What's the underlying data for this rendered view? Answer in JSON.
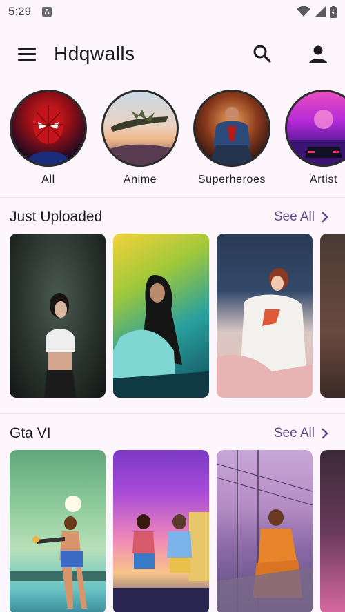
{
  "status_bar": {
    "time": "5:29",
    "notification_icon": "a-icon",
    "right_icons": [
      "wifi-icon",
      "signal-icon",
      "battery-icon"
    ]
  },
  "app_bar": {
    "title": "Hdqwalls",
    "left_icon": "menu-icon",
    "right_icons": [
      "search-icon",
      "account-icon"
    ]
  },
  "categories": [
    {
      "label": "All"
    },
    {
      "label": "Anime"
    },
    {
      "label": "Superheroes"
    },
    {
      "label": "Artist"
    }
  ],
  "sections": [
    {
      "title": "Just Uploaded",
      "action": "See All"
    },
    {
      "title": "Gta VI",
      "action": "See All"
    }
  ],
  "colors": {
    "background": "#fdf7fd",
    "accent": "#5b4a8c",
    "text": "#1d1b20"
  }
}
